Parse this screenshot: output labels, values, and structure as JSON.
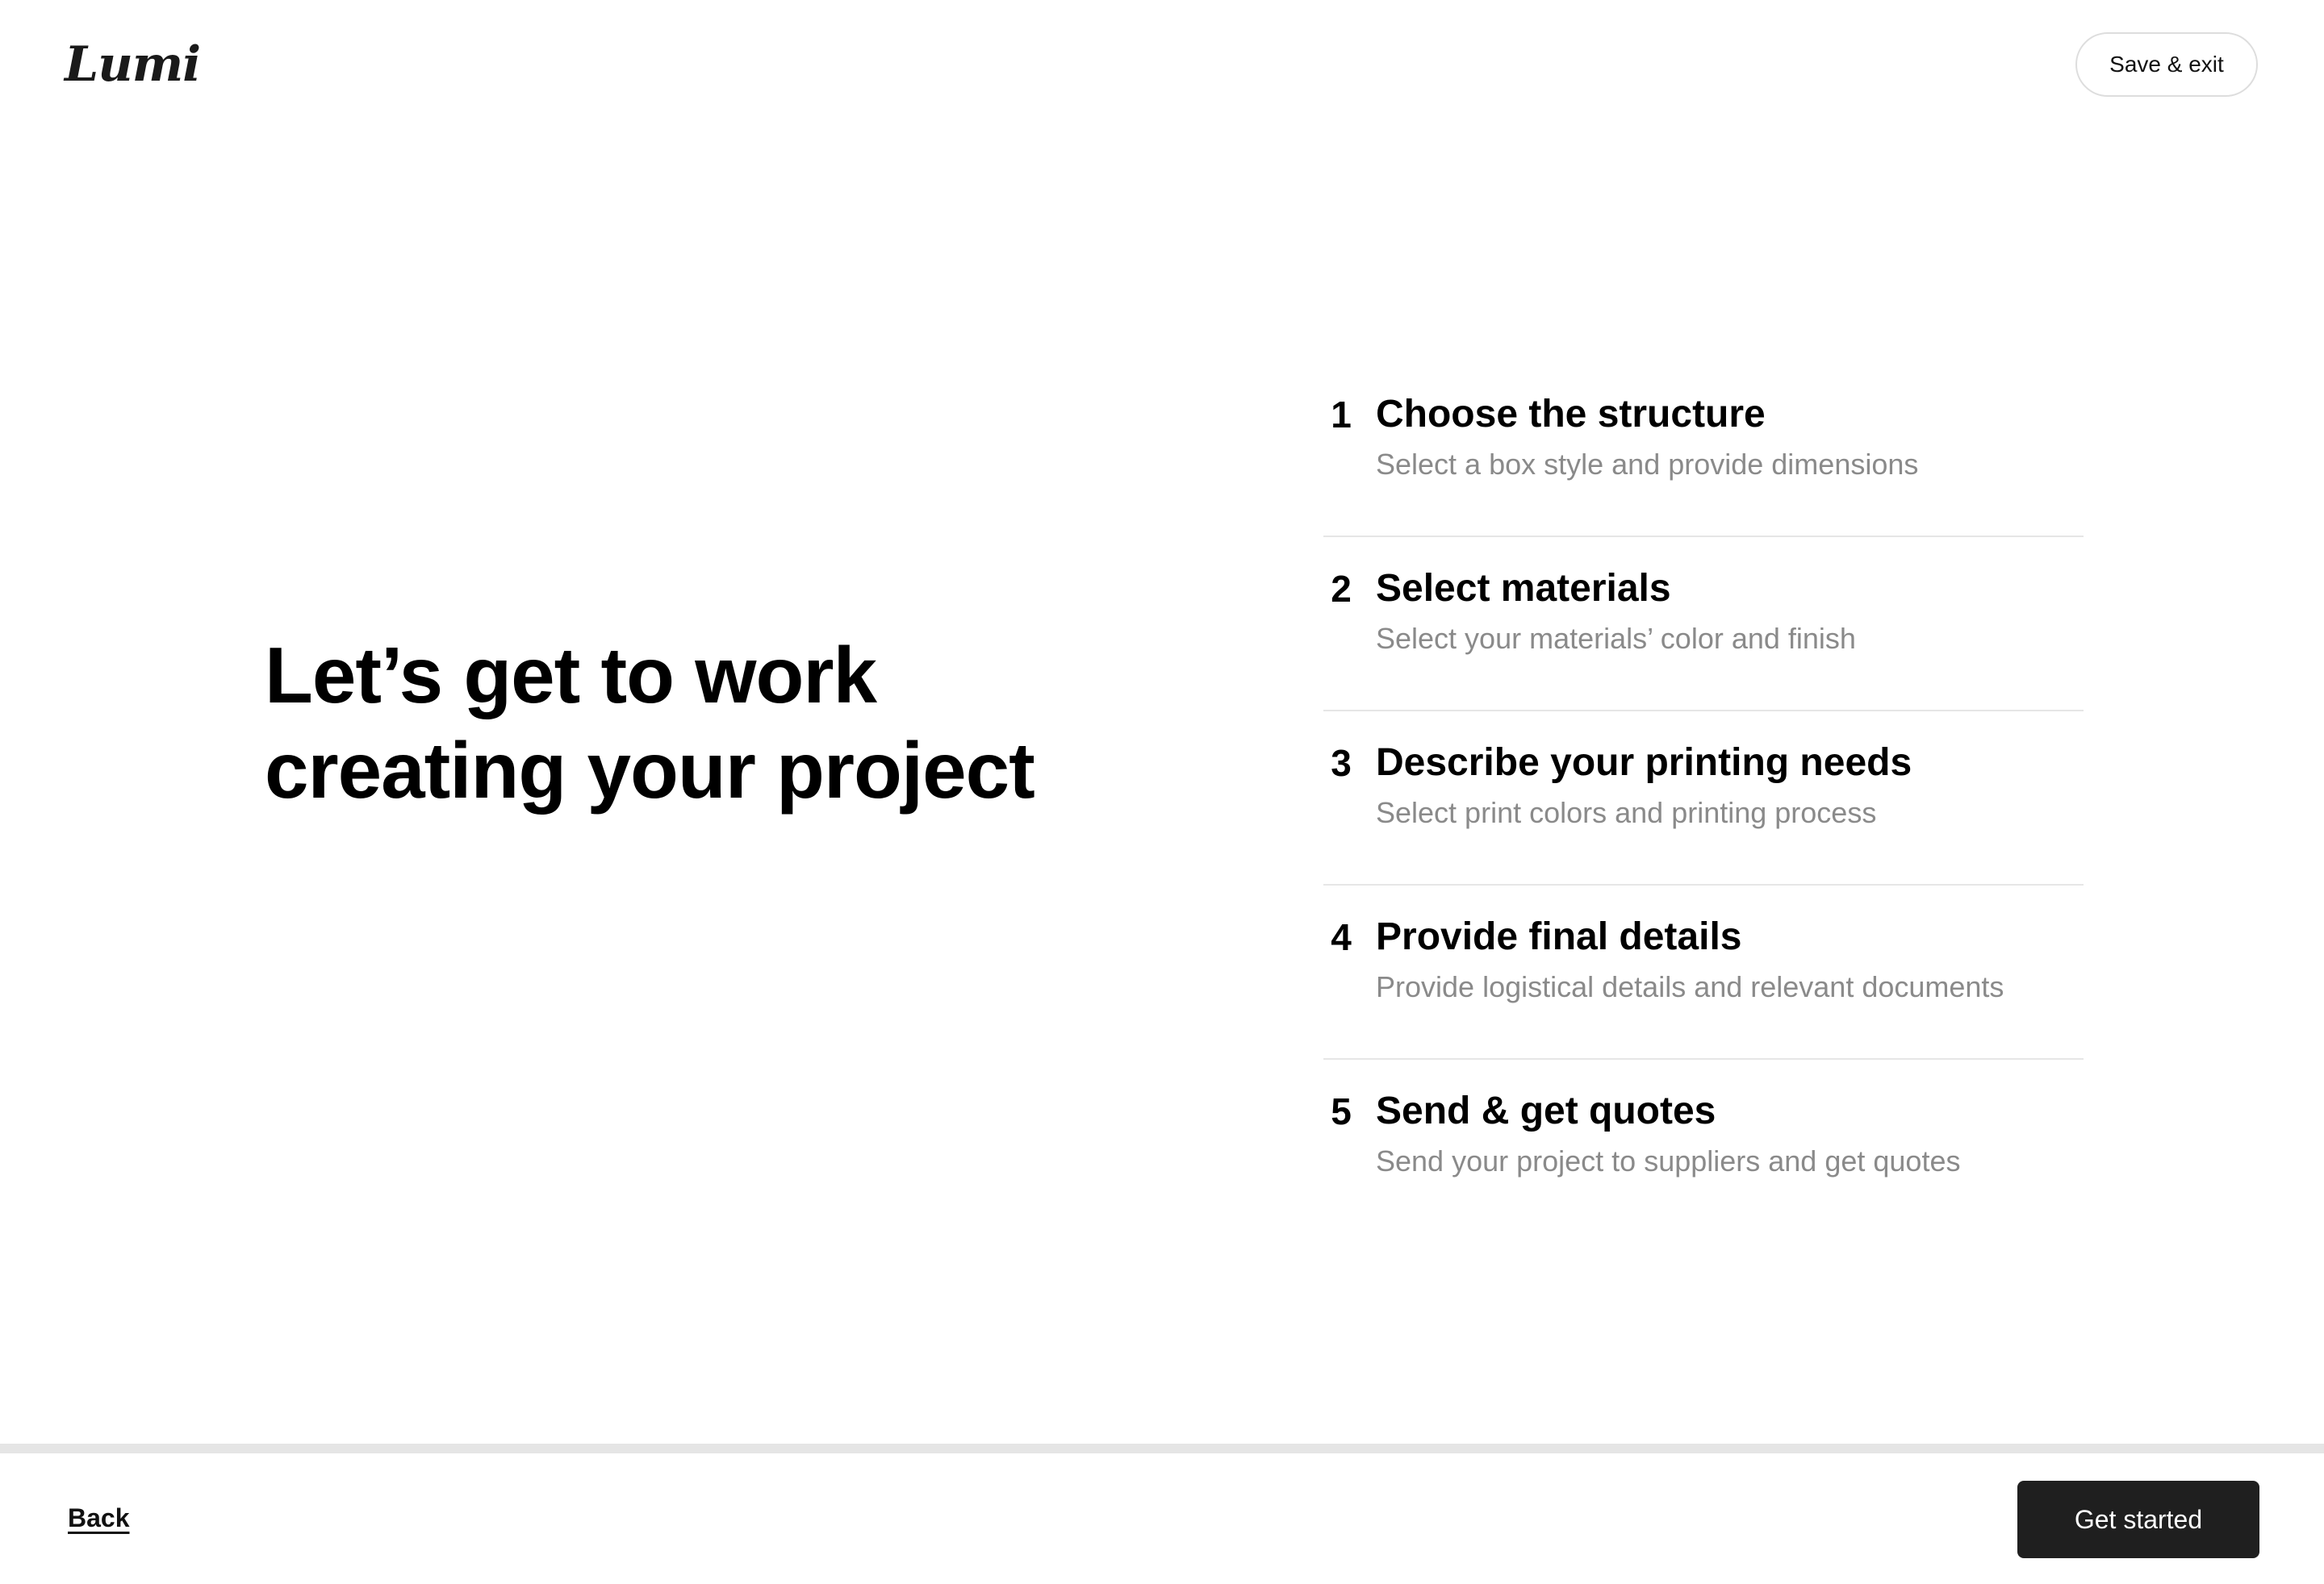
{
  "header": {
    "logo_text": "Lumi",
    "save_exit_label": "Save & exit"
  },
  "hero": {
    "title_line1": "Let’s get to work",
    "title_line2": "creating your project"
  },
  "steps": [
    {
      "number": "1",
      "title": "Choose the structure",
      "description": "Select a box style and provide dimensions"
    },
    {
      "number": "2",
      "title": "Select materials",
      "description": "Select your materials’ color and finish"
    },
    {
      "number": "3",
      "title": "Describe your printing needs",
      "description": "Select print colors and printing process"
    },
    {
      "number": "4",
      "title": "Provide final details",
      "description": "Provide logistical details and relevant documents"
    },
    {
      "number": "5",
      "title": "Send & get quotes",
      "description": "Send your project to suppliers and get quotes"
    }
  ],
  "progress": {
    "fraction": 0
  },
  "footer": {
    "back_label": "Back",
    "get_started_label": "Get started"
  },
  "colors": {
    "primary_button": "#1f1f1f",
    "muted_text": "#8a8a8a",
    "divider": "#e6e6e6",
    "progress_track": "#e5e5e5"
  }
}
